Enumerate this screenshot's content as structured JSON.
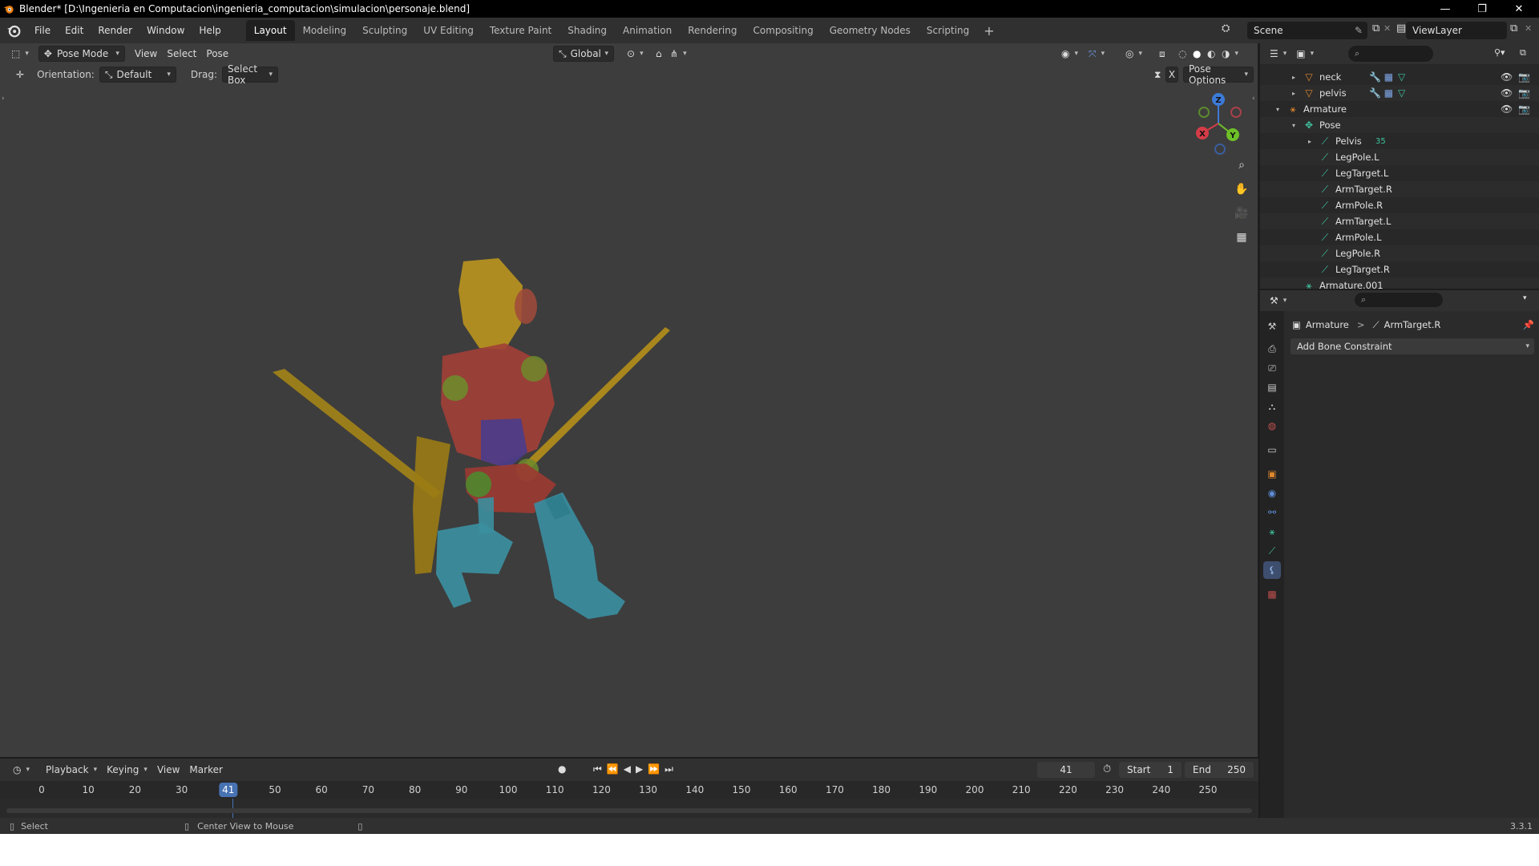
{
  "window": {
    "title": "Blender* [D:\\Ingenieria en Computacion\\ingenieria_computacion\\simulacion\\personaje.blend]",
    "minimize": "—",
    "restore": "❐",
    "close": "✕"
  },
  "menu": [
    "File",
    "Edit",
    "Render",
    "Window",
    "Help"
  ],
  "workspaces": [
    "Layout",
    "Modeling",
    "Sculpting",
    "UV Editing",
    "Texture Paint",
    "Shading",
    "Animation",
    "Rendering",
    "Compositing",
    "Geometry Nodes",
    "Scripting"
  ],
  "active_workspace": "Layout",
  "scene": {
    "name": "Scene",
    "view_layer": "ViewLayer"
  },
  "viewport": {
    "mode": "Pose Mode",
    "menus": [
      "View",
      "Select",
      "Pose"
    ],
    "transform_orientation": "Global",
    "orientation_label": "Orientation:",
    "orientation_value": "Default",
    "drag_label": "Drag:",
    "drag_value": "Select Box",
    "pose_options": "Pose Options",
    "x_mirror": "X",
    "gizmo": {
      "x": "X",
      "y": "Y",
      "z": "Z"
    }
  },
  "outliner": {
    "rows": [
      {
        "label": "neck",
        "depth": 1,
        "expand": "▸",
        "icon": "mesh-icon"
      },
      {
        "label": "pelvis",
        "depth": 1,
        "expand": "▸",
        "icon": "mesh-icon"
      },
      {
        "label": "Armature",
        "depth": 0,
        "expand": "▾",
        "icon": "armature-icon"
      },
      {
        "label": "Pose",
        "depth": 1,
        "expand": "▾",
        "icon": "pose-icon"
      },
      {
        "label": "Pelvis",
        "depth": 2,
        "expand": "▸",
        "icon": "bone-icon",
        "badge": "35"
      },
      {
        "label": "LegPole.L",
        "depth": 2,
        "icon": "bone-icon"
      },
      {
        "label": "LegTarget.L",
        "depth": 2,
        "icon": "bone-icon"
      },
      {
        "label": "ArmTarget.R",
        "depth": 2,
        "icon": "bone-icon"
      },
      {
        "label": "ArmPole.R",
        "depth": 2,
        "icon": "bone-icon"
      },
      {
        "label": "ArmTarget.L",
        "depth": 2,
        "icon": "bone-icon"
      },
      {
        "label": "ArmPole.L",
        "depth": 2,
        "icon": "bone-icon"
      },
      {
        "label": "LegPole.R",
        "depth": 2,
        "icon": "bone-icon"
      },
      {
        "label": "LegTarget.R",
        "depth": 2,
        "icon": "bone-icon"
      },
      {
        "label": "Armature.001",
        "depth": 1,
        "icon": "armature-data-icon"
      }
    ]
  },
  "properties": {
    "breadcrumb_object": "Armature",
    "breadcrumb_separator": ">",
    "breadcrumb_bone": "ArmTarget.R",
    "add_constraint": "Add Bone Constraint"
  },
  "timeline": {
    "menus": [
      "Playback",
      "Keying",
      "View",
      "Marker"
    ],
    "current_frame": "41",
    "start_label": "Start",
    "start": "1",
    "end_label": "End",
    "end": "250",
    "ticks": [
      "0",
      "10",
      "20",
      "30",
      "41",
      "50",
      "60",
      "70",
      "80",
      "90",
      "100",
      "110",
      "120",
      "130",
      "140",
      "150",
      "160",
      "170",
      "180",
      "190",
      "200",
      "210",
      "220",
      "230",
      "240",
      "250"
    ]
  },
  "statusbar": {
    "select": "Select",
    "center_view": "Center View to Mouse",
    "version": "3.3.1"
  },
  "colors": {
    "accent": "#4772b3",
    "viewport_bg": "#3d3d3d",
    "bone_green": "#3fc4a0",
    "playhead": "#4772b3"
  }
}
